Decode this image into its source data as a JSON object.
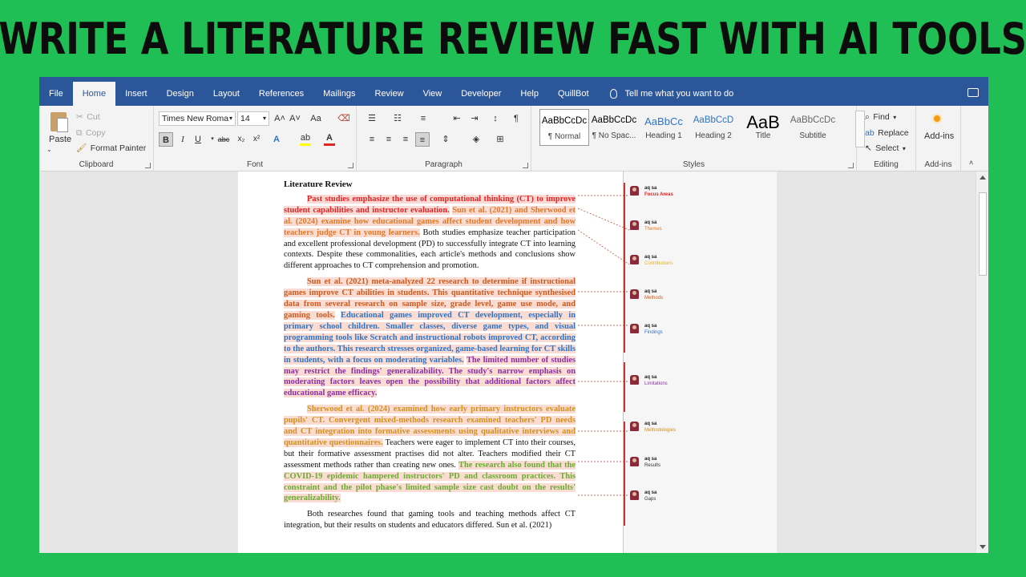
{
  "banner": {
    "title": "WRITE A LITERATURE REVIEW FAST WITH AI TOOLS"
  },
  "menu": {
    "tabs": [
      "File",
      "Home",
      "Insert",
      "Design",
      "Layout",
      "References",
      "Mailings",
      "Review",
      "View",
      "Developer",
      "Help",
      "QuillBot"
    ],
    "active_tab": "Home",
    "tell_me": "Tell me what you want to do"
  },
  "ribbon": {
    "clipboard": {
      "paste": "Paste",
      "cut": "Cut",
      "copy": "Copy",
      "format_painter": "Format Painter",
      "label": "Clipboard"
    },
    "font": {
      "name": "Times New Roma",
      "size": "14",
      "label": "Font",
      "grow": "A˄",
      "shrink": "A˅",
      "case": "Aa",
      "bold": "B",
      "italic": "I",
      "underline": "U",
      "strike": "abc",
      "subscript": "x₂",
      "superscript": "x²"
    },
    "paragraph": {
      "label": "Paragraph"
    },
    "styles": {
      "label": "Styles",
      "items": [
        {
          "sample": "AaBbCcDc",
          "name": "¶ Normal"
        },
        {
          "sample": "AaBbCcDc",
          "name": "¶ No Spac..."
        },
        {
          "sample": "AaBbCc",
          "name": "Heading 1"
        },
        {
          "sample": "AaBbCcD",
          "name": "Heading 2"
        },
        {
          "sample": "AaB",
          "name": "Title"
        },
        {
          "sample": "AaBbCcDc",
          "name": "Subtitle"
        }
      ]
    },
    "editing": {
      "find": "Find",
      "replace": "Replace",
      "select": "Select",
      "label": "Editing"
    },
    "addins": {
      "button": "Add-ins",
      "label": "Add-ins"
    }
  },
  "document": {
    "heading": "Literature Review",
    "p1": {
      "red": "Past studies emphasize the use of computational thinking (CT) to improve student capabilities and instructor evaluation.",
      "orange": "Sun et al. (2021) and Sherwood et al. (2024) examine how educational games affect student development and how teachers judge CT in young learners.",
      "plain": "Both studies emphasize teacher participation and excellent professional development (PD) to successfully integrate CT into learning contexts. Despite these commonalities, each article's methods and conclusions show different approaches to CT comprehension and promotion."
    },
    "p2": {
      "orange": "Sun et al. (2021) meta-analyzed 22 research to determine if instructional games improve CT abilities in students. This quantitative technique synthesised data from several research on sample size, grade level, game use mode, and gaming tools.",
      "blue": "Educational games improved CT development, especially in primary school children. Smaller classes, diverse game types, and visual programming tools like Scratch and instructional robots improved CT, according to the authors. This research stresses organized, game-based learning for CT skills in students, with a focus on moderating variables.",
      "purple": "The limited number of studies may restrict the findings' generalizability. The study's narrow emphasis on moderating factors leaves open the possibility that additional factors affect educational game efficacy."
    },
    "p3": {
      "gold": "Sherwood et al. (2024) examined how early primary instructors evaluate pupils' CT. Convergent mixed-methods research examined teachers' PD needs and CT integration into formative assessments using qualitative interviews and quantitative questionnaires.",
      "plain": "Teachers were eager to implement CT into their courses, but their formative assessment practises did not alter. Teachers modified their CT assessment methods rather than creating new ones.",
      "green": "The research also found that the COVID-19 epidemic hampered instructors' PD and classroom practices. This constraint and the pilot phase's limited sample size cast doubt on the results' generalizability."
    },
    "p4": "Both researches found that gaming tools and teaching methods affect CT integration, but their results on students and educators differed. Sun et al. (2021)"
  },
  "comments": [
    {
      "author": "aq sa",
      "text": "Focus Areas",
      "color": "#e02424"
    },
    {
      "author": "aq sa",
      "text": "Themes",
      "color": "#e27826"
    },
    {
      "author": "aq sa",
      "text": "Contributions",
      "color": "#e8b21c"
    },
    {
      "author": "aq sa",
      "text": "Methods",
      "color": "#cc5a1e"
    },
    {
      "author": "aq sa",
      "text": "Findings",
      "color": "#2f73c6"
    },
    {
      "author": "aq sa",
      "text": "Limitations",
      "color": "#8a2fa6"
    },
    {
      "author": "aq sa",
      "text": "Methodologies",
      "color": "#d2901c"
    },
    {
      "author": "aq sa",
      "text": "Results",
      "color": "#333333"
    },
    {
      "author": "aq sa",
      "text": "Gaps",
      "color": "#333333"
    }
  ]
}
